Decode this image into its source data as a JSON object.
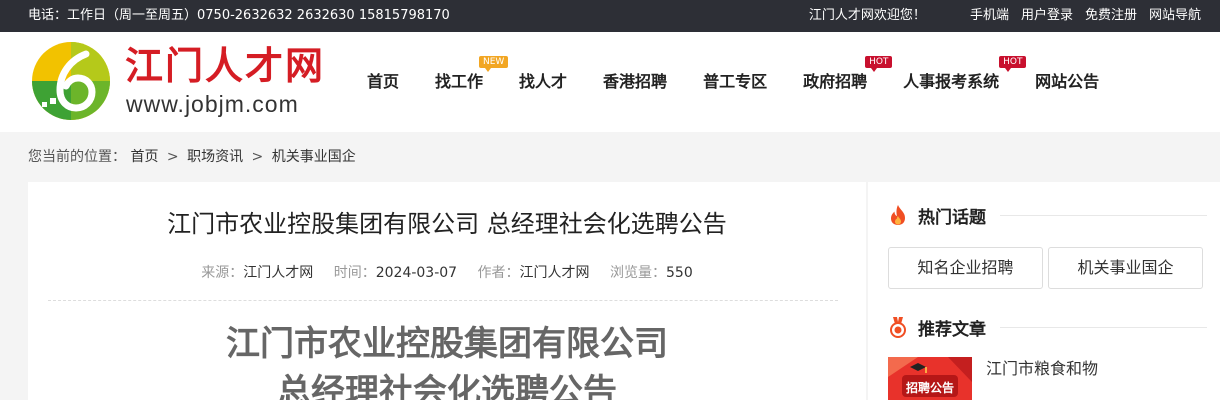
{
  "topbar": {
    "contact": "电话：工作日（周一至周五）0750-2632632 2632630 15815798170",
    "welcome": "江门人才网欢迎您！",
    "links": [
      "手机端",
      "用户登录",
      "免费注册",
      "网站导航"
    ]
  },
  "logo": {
    "title": "江门人才网",
    "url": "www.jobjm.com"
  },
  "nav": {
    "items": [
      {
        "label": "首页",
        "badge": ""
      },
      {
        "label": "找工作",
        "badge": "NEW"
      },
      {
        "label": "找人才",
        "badge": ""
      },
      {
        "label": "香港招聘",
        "badge": ""
      },
      {
        "label": "普工专区",
        "badge": ""
      },
      {
        "label": "政府招聘",
        "badge": "HOT"
      },
      {
        "label": "人事报考系统",
        "badge": "HOT"
      },
      {
        "label": "网站公告",
        "badge": ""
      }
    ]
  },
  "breadcrumb": {
    "prefix": "您当前的位置：",
    "items": [
      "首页",
      "职场资讯",
      "机关事业国企"
    ],
    "sep": ">"
  },
  "article": {
    "title": "江门市农业控股集团有限公司 总经理社会化选聘公告",
    "source_label": "来源：",
    "source": "江门人才网",
    "time_label": "时间：",
    "time": "2024-03-07",
    "author_label": "作者：",
    "author": "江门人才网",
    "views_label": "浏览量：",
    "views": "550",
    "heading_line1": "江门市农业控股集团有限公司",
    "heading_line2": "总经理社会化选聘公告"
  },
  "sidebar": {
    "hot_title": "热门话题",
    "hot_tags": [
      "知名企业招聘",
      "机关事业国企"
    ],
    "rec_title": "推荐文章",
    "rec_thumb_text": "招聘公告",
    "rec_item": "江门市粮食和物"
  },
  "colors": {
    "brand_red": "#d51d24",
    "topbar_bg": "#2d2f36",
    "new_badge": "#f2a623",
    "hot_badge": "#c8102e"
  }
}
